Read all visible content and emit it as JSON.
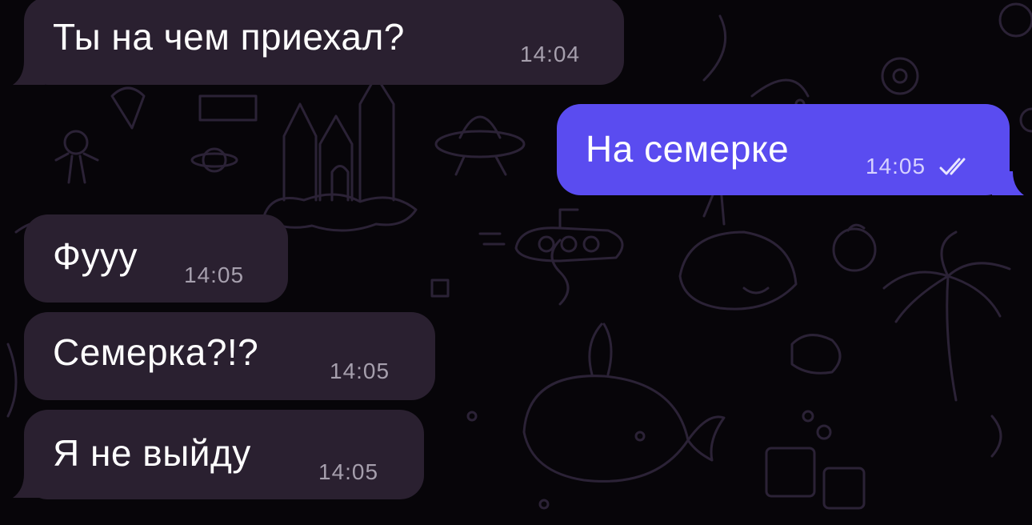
{
  "chat": {
    "messages": [
      {
        "direction": "incoming",
        "text": "Ты на чем приехал?",
        "time": "14:04"
      },
      {
        "direction": "outgoing",
        "text": "На семерке",
        "time": "14:05",
        "status": "read"
      },
      {
        "direction": "incoming",
        "text": "Фууу",
        "time": "14:05"
      },
      {
        "direction": "incoming",
        "text": "Семерка?!?",
        "time": "14:05"
      },
      {
        "direction": "incoming",
        "text": "Я не выйду",
        "time": "14:05"
      }
    ]
  },
  "colors": {
    "background": "#070509",
    "incoming_bubble": "#2a2030",
    "outgoing_bubble": "#5a4cf0",
    "doodle_stroke": "#2b2236"
  },
  "icons": {
    "read_receipt": "double-check-icon"
  }
}
